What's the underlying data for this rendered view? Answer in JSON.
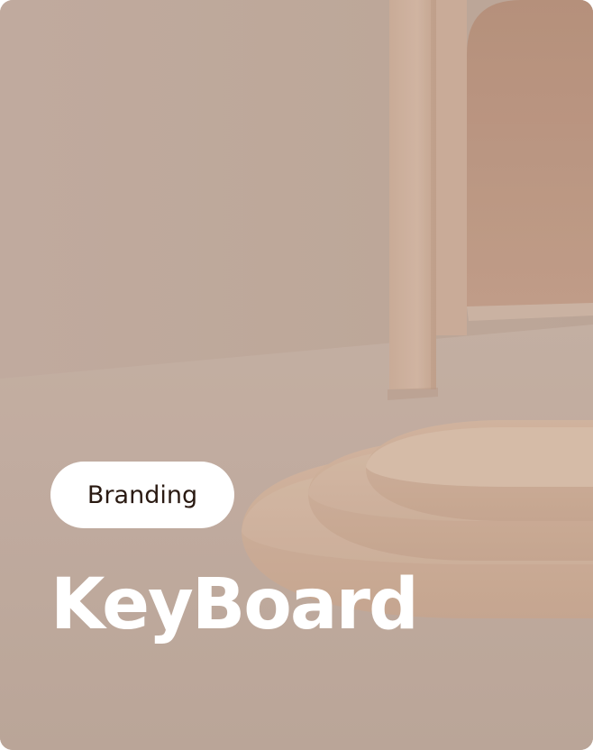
{
  "card": {
    "tag_label": "Branding",
    "title": "KeyBoard"
  },
  "colors": {
    "background": "#c7b1a4",
    "pill_background": "#ffffff",
    "pill_text": "#2a1a12",
    "title_text": "#ffffff"
  }
}
